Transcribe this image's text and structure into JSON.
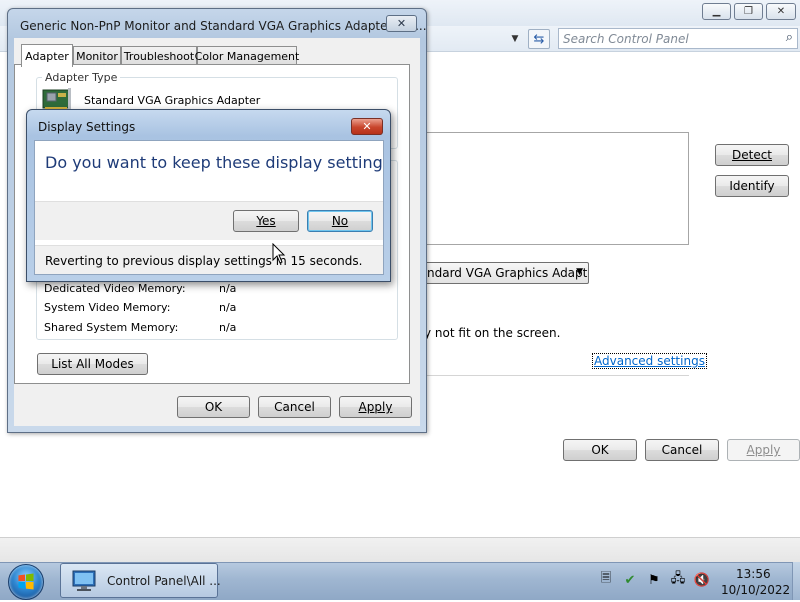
{
  "background_window": {
    "search_placeholder": "Search Control Panel",
    "detect_label": "Detect",
    "identify_label": "Identify",
    "display_select_value": "ndard VGA Graphics Adapter",
    "fit_text": "y not fit on the screen.",
    "advanced_link": "Advanced settings",
    "ok_label": "OK",
    "cancel_label": "Cancel",
    "apply_label": "Apply"
  },
  "properties_window": {
    "title": "Generic Non-PnP Monitor and Standard VGA Graphics Adapter Pro...",
    "tabs": [
      {
        "label": "Adapter"
      },
      {
        "label": "Monitor"
      },
      {
        "label": "Troubleshoot"
      },
      {
        "label": "Color Management"
      }
    ],
    "adapter_type_legend": "Adapter Type",
    "adapter_name": "Standard VGA Graphics Adapter",
    "memory_rows": [
      {
        "label": "Dedicated Video Memory:",
        "value": "n/a"
      },
      {
        "label": "System Video Memory:",
        "value": "n/a"
      },
      {
        "label": "Shared System Memory:",
        "value": "n/a"
      }
    ],
    "list_modes_label": "List All Modes",
    "ok_label": "OK",
    "cancel_label": "Cancel",
    "apply_label": "Apply"
  },
  "dialog": {
    "title": "Display Settings",
    "question": "Do you want to keep these display settings?",
    "yes_label": "Yes",
    "no_label": "No",
    "footer_text": "Reverting to previous display settings in 15 seconds."
  },
  "taskbar": {
    "item_label": "Control Panel\\All ...",
    "time": "13:56",
    "date": "10/10/2022"
  }
}
